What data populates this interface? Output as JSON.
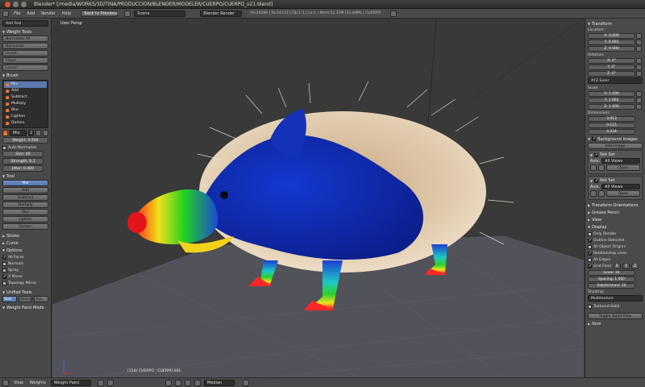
{
  "window": {
    "title": "Blender* [/media/WORKS/3D/TINA/PRODUCCION/BLENDER/MODELER/CUERPO/CUERPO_v21.blend]"
  },
  "menubar": {
    "menus": [
      "File",
      "Add",
      "Render",
      "Help"
    ],
    "back_button": "Back to Previous",
    "scene": "Scene",
    "render_engine": "Blender Render",
    "stats": "Ve:24289 | Fa:24233 | Ob:1-1 | La:1 | Mem:52.32M (51.89M) | CUERPO"
  },
  "toolshelf": {
    "add_tool": "Add Tool",
    "weight_tools": {
      "title": "Weight Tools",
      "buttons": [
        "Normalize All",
        "Normalize",
        "Invert",
        "Clean",
        "Levels"
      ]
    },
    "brush": {
      "title": "Brush",
      "items": [
        "Mix",
        "Add",
        "Subtract",
        "Multiply",
        "Blur",
        "Lighten",
        "Darken"
      ],
      "selected": "Mix",
      "brush_name": "Mix",
      "brush_users": "2",
      "weight": "Weight: 0.000",
      "auto_normalize": "Auto Normalize",
      "size": "Size: 46",
      "strength": "Strength: 0.1",
      "jitter": "Jitter: 0.000"
    },
    "tool": {
      "title": "Tool",
      "items": [
        "Mix",
        "Add",
        "Subtract",
        "Multiply",
        "Blur",
        "Lighten",
        "Darken"
      ],
      "selected": "Mix"
    },
    "stroke": "Stroke",
    "curve": "Curve",
    "options": {
      "title": "Options",
      "checks": [
        {
          "label": "All Faces",
          "checked": true
        },
        {
          "label": "Normals",
          "checked": false
        },
        {
          "label": "Spray",
          "checked": false
        },
        {
          "label": "X Mirror",
          "checked": true
        },
        {
          "label": "Topology Mirror",
          "checked": false
        }
      ]
    },
    "unified": {
      "title": "Unified Tools",
      "buttons": [
        "Size",
        "Strength",
        "ALL"
      ]
    },
    "weight_paint_mode": "Weight Paint Mode"
  },
  "viewport": {
    "label": "User Persp",
    "info": "(154) CUERPO : CUERPO.001"
  },
  "props": {
    "transform": "Transform",
    "location_label": "Location:",
    "location": [
      "X: 0.000",
      "Y: 0.000",
      "Z: 0.000"
    ],
    "rotation_label": "Rotation:",
    "rotation": [
      "X: 0°",
      "Y: 0°",
      "Z: 0°"
    ],
    "rotation_mode": "XYZ Euler",
    "scale_label": "Scale:",
    "scale": [
      "X: 1.000",
      "Y: 1.000",
      "Z: 1.000"
    ],
    "dimensions_label": "Dimensions:",
    "dimensions": [
      "3.913",
      "9.115",
      "4.434"
    ],
    "background_images": "Background Images",
    "add_image": "Add Image",
    "not_set_1": "Not Set",
    "axis_label": "Axis:",
    "axis_value": "All Views",
    "open": "Open",
    "not_set_2": "Not Set",
    "transform_orientations": "Transform Orientations",
    "grease_pencil": "Grease Pencil",
    "view": "View",
    "display": "Display",
    "display_checks": [
      {
        "label": "Only Render",
        "checked": false
      },
      {
        "label": "Outline Selected",
        "checked": true
      },
      {
        "label": "All Object Origins",
        "checked": false
      },
      {
        "label": "Relationship Lines",
        "checked": true
      },
      {
        "label": "All Edges",
        "checked": false
      }
    ],
    "grid_floor": "Grid Floor",
    "grid_axes": [
      "X",
      "Y",
      "Z"
    ],
    "lines": "Lines: 16",
    "spacing": "Spacing: 1.000",
    "subdivisions": "Subdivisions: 10",
    "shading_label": "Shading:",
    "shading": "Multitexture",
    "textured_solid": "Textured Solid",
    "toggle_quad": "Toggle Quad View",
    "item": "Item"
  },
  "bottombar": {
    "view": "View",
    "weights": "Weights",
    "mode": "Weight Paint",
    "pivot": "Median"
  }
}
